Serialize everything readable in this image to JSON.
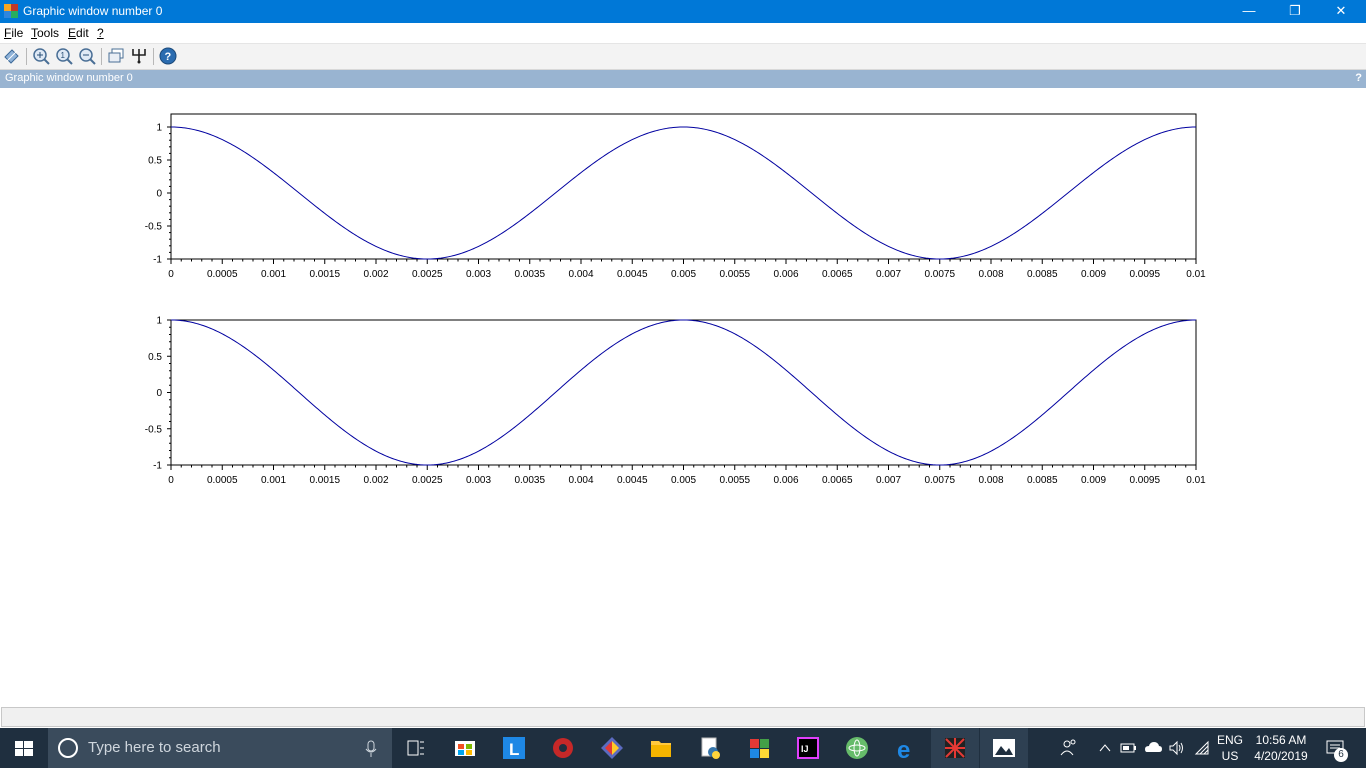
{
  "window": {
    "title": "Graphic window number 0",
    "minimize_glyph": "—",
    "restore_glyph": "❐",
    "close_glyph": "✕"
  },
  "menu": [
    {
      "accel": "F",
      "rest": "ile"
    },
    {
      "accel": "T",
      "rest": "ools"
    },
    {
      "accel": "E",
      "rest": "dit"
    },
    {
      "accel": "?",
      "rest": ""
    }
  ],
  "toolbar": {
    "icons": [
      "datatip-icon",
      "zoom-in-icon",
      "zoom-reset-icon",
      "zoom-out-icon",
      "rotate-icon",
      "axes-edit-icon",
      "help-icon"
    ]
  },
  "panel": {
    "title": "Graphic window number 0",
    "help": "?"
  },
  "chart_data": [
    {
      "type": "line",
      "title": "",
      "xlabel": "",
      "ylabel": "",
      "xlim": [
        0,
        0.01
      ],
      "ylim": [
        -1,
        1
      ],
      "x_ticks": [
        "0",
        "0.0005",
        "0.001",
        "0.0015",
        "0.002",
        "0.0025",
        "0.003",
        "0.0035",
        "0.004",
        "0.0045",
        "0.005",
        "0.0055",
        "0.006",
        "0.0065",
        "0.007",
        "0.0075",
        "0.008",
        "0.0085",
        "0.009",
        "0.0095",
        "0.01"
      ],
      "y_ticks": [
        "1",
        "0.5",
        "0",
        "-0.5",
        "-1"
      ],
      "series": [
        {
          "function": "cos(2*pi*200*x)",
          "frequency_hz": 200,
          "amplitude": 1,
          "color": "#0000a0",
          "points": [
            [
              0,
              1
            ],
            [
              0.0025,
              -1
            ],
            [
              0.005,
              1
            ],
            [
              0.0075,
              -1
            ],
            [
              0.01,
              1
            ]
          ]
        }
      ],
      "grid": false,
      "box": true
    },
    {
      "type": "line",
      "title": "",
      "xlabel": "",
      "ylabel": "",
      "xlim": [
        0,
        0.01
      ],
      "ylim": [
        -1,
        1
      ],
      "x_ticks": [
        "0",
        "0.0005",
        "0.001",
        "0.0015",
        "0.002",
        "0.0025",
        "0.003",
        "0.0035",
        "0.004",
        "0.0045",
        "0.005",
        "0.0055",
        "0.006",
        "0.0065",
        "0.007",
        "0.0075",
        "0.008",
        "0.0085",
        "0.009",
        "0.0095",
        "0.01"
      ],
      "y_ticks": [
        "1",
        "0.5",
        "0",
        "-0.5",
        "-1"
      ],
      "series": [
        {
          "function": "cos(2*pi*200*x)",
          "frequency_hz": 200,
          "amplitude": 1,
          "color": "#0000a0",
          "points": [
            [
              0,
              1
            ],
            [
              0.0025,
              -1
            ],
            [
              0.005,
              1
            ],
            [
              0.0075,
              -1
            ],
            [
              0.01,
              1
            ]
          ]
        }
      ],
      "grid": false,
      "box": true
    }
  ],
  "taskbar": {
    "search_placeholder": "Type here to search",
    "apps": [
      "task-view-icon",
      "store-icon",
      "l-app-icon",
      "media-app-icon",
      "git-icon",
      "file-explorer-icon",
      "python-icon",
      "windows-tiles-icon",
      "intellij-icon",
      "atom-icon",
      "edge-icon",
      "scilab-icon",
      "photos-icon"
    ],
    "tray": {
      "language": "ENG",
      "region": "US",
      "time": "10:56 AM",
      "date": "4/20/2019",
      "notifications": "6"
    }
  }
}
